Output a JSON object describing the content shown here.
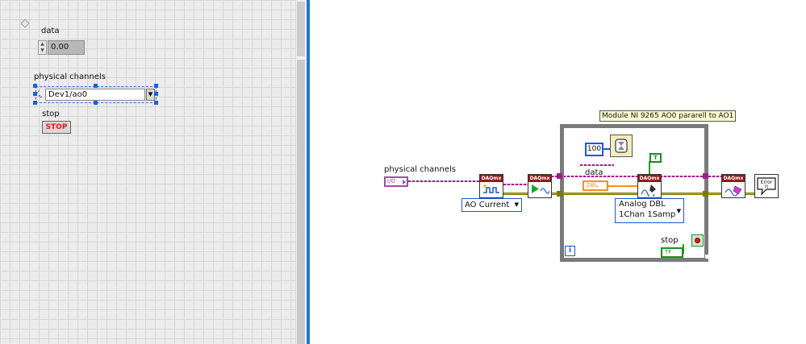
{
  "front_panel": {
    "numeric_indicator": {
      "label": "data",
      "value": "0.00"
    },
    "channel_control": {
      "label": "physical channels",
      "value": "Dev1/ao0"
    },
    "stop_button": {
      "label": "stop",
      "text": "STOP"
    }
  },
  "block_diagram": {
    "channel_label": "physical channels",
    "io_constant_text": "I/O",
    "vi_header": "DAQmx",
    "ao_current_enum": "AO Current",
    "comment": "Module NI 9265  AO0 pararell to AO1",
    "wait_constant": "100",
    "true_constant": "T",
    "data_label": "data",
    "data_terminal_text": "DBL",
    "write_mode_line1": "Analog DBL",
    "write_mode_line2": "1Chan 1Samp",
    "stop_label": "stop",
    "stop_terminal_text": "TF",
    "iteration_terminal": "i",
    "error_vi_text": "Error ?!"
  },
  "colors": {
    "divider": "#1f78d1",
    "daqmx_header": "#8b1d1d",
    "task_wire": "#a01e8c",
    "error_wire": "#b9b400",
    "double_wire": "#ff8c1a",
    "boolean_wire": "#1a9e28",
    "numeric_wire": "#1f57d6",
    "stop_text": "#e41a1a"
  }
}
